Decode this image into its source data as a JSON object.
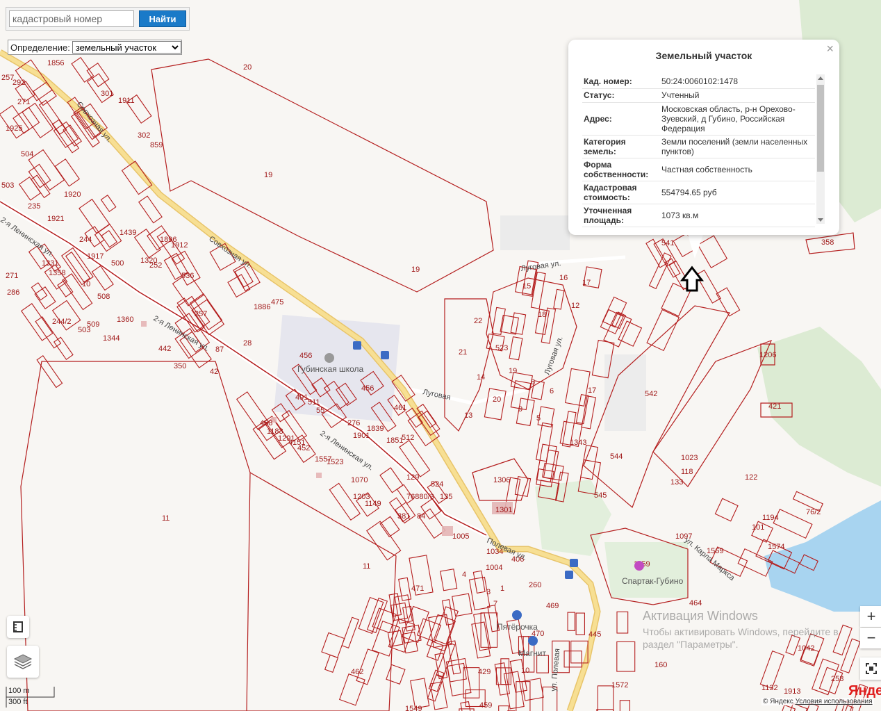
{
  "search": {
    "placeholder": "кадастровый номер",
    "button_label": "Найти"
  },
  "definition": {
    "label": "Определение:",
    "selected": "земельный участок"
  },
  "popup": {
    "title": "Земельный участок",
    "close": "×",
    "rows": [
      {
        "key": "Кад. номер:",
        "value": "50:24:0060102:1478"
      },
      {
        "key": "Статус:",
        "value": "Учтенный"
      },
      {
        "key": "Адрес:",
        "value": "Московская область, р-н Орехово-Зуевский, д Губино, Российская Федерация"
      },
      {
        "key": "Категория земель:",
        "value": "Земли поселений (земли населенных пунктов)"
      },
      {
        "key": "Форма собственности:",
        "value": "Частная собственность"
      },
      {
        "key": "Кадастровая стоимость:",
        "value": "554794.65 руб"
      },
      {
        "key": "Уточненная площадь:",
        "value": "1073 кв.м"
      }
    ]
  },
  "map": {
    "parcel_labels": [
      "20",
      "19",
      "19",
      "11",
      "11",
      "1856",
      "1911",
      "301",
      "302",
      "859",
      "292",
      "257",
      "271",
      "1925",
      "504",
      "503",
      "235",
      "1920",
      "1921",
      "1439",
      "1896",
      "1912",
      "244",
      "1917",
      "500",
      "1320",
      "252",
      "536",
      "1331",
      "1358",
      "271",
      "286",
      "10",
      "244/2",
      "508",
      "509",
      "503",
      "1360",
      "1344",
      "442",
      "350",
      "257",
      "1886",
      "475",
      "28",
      "87",
      "42",
      "456",
      "456",
      "491",
      "511",
      "55",
      "276",
      "1901",
      "1839",
      "1851",
      "512",
      "461",
      "458",
      "1183",
      "1291",
      "4151",
      "452",
      "1557",
      "1523",
      "1070",
      "1203",
      "1149",
      "76880/3",
      "524",
      "129",
      "135",
      "381",
      "84",
      "1005",
      "1034",
      "406",
      "1301",
      "1306",
      "523",
      "15",
      "16",
      "17",
      "18",
      "12",
      "22",
      "21",
      "19",
      "14",
      "20",
      "13",
      "9",
      "5",
      "8",
      "6",
      "17",
      "1343",
      "542",
      "544",
      "545",
      "541",
      "358",
      "1206",
      "421",
      "1023",
      "118",
      "133",
      "122",
      "76/2",
      "1194",
      "101",
      "1574",
      "1097",
      "1569",
      "1159",
      "464",
      "260",
      "469",
      "470",
      "429",
      "462",
      "445",
      "1042",
      "160",
      "258",
      "1132",
      "1913",
      "1572",
      "1549",
      "459",
      "471",
      "1004",
      "4",
      "3",
      "1",
      "7",
      "10",
      "6",
      "11"
    ],
    "streets": [
      "Совхозная ул.",
      "Совхозная ул.",
      "2-я Ленинская ул.",
      "2-я Ленинская ул.",
      "2-я Ленинская ул.",
      "Луговая ул.",
      "Луговая",
      "Луговая ул.",
      "Полевая ул.",
      "ул. Карла Маркса",
      "ул. Полевая"
    ],
    "pois": [
      "Губинская школа",
      "Спартак-Губино",
      "Пятёрочка",
      "Магнит"
    ]
  },
  "controls": {
    "zoom_in": "+",
    "zoom_out": "−"
  },
  "scale": {
    "metric": "100 m",
    "imperial": "300 ft"
  },
  "watermark": {
    "line1": "Активация Windows",
    "line2": "Чтобы активировать Windows, перейдите в раздел \"Параметры\"."
  },
  "copyright": {
    "text": "© Яндекс",
    "link": "Условия использования"
  },
  "logo": "Яндекс",
  "colors": {
    "parcel_line": "#b41e1e",
    "road": "#f7d77a",
    "button": "#1a7ac8"
  }
}
